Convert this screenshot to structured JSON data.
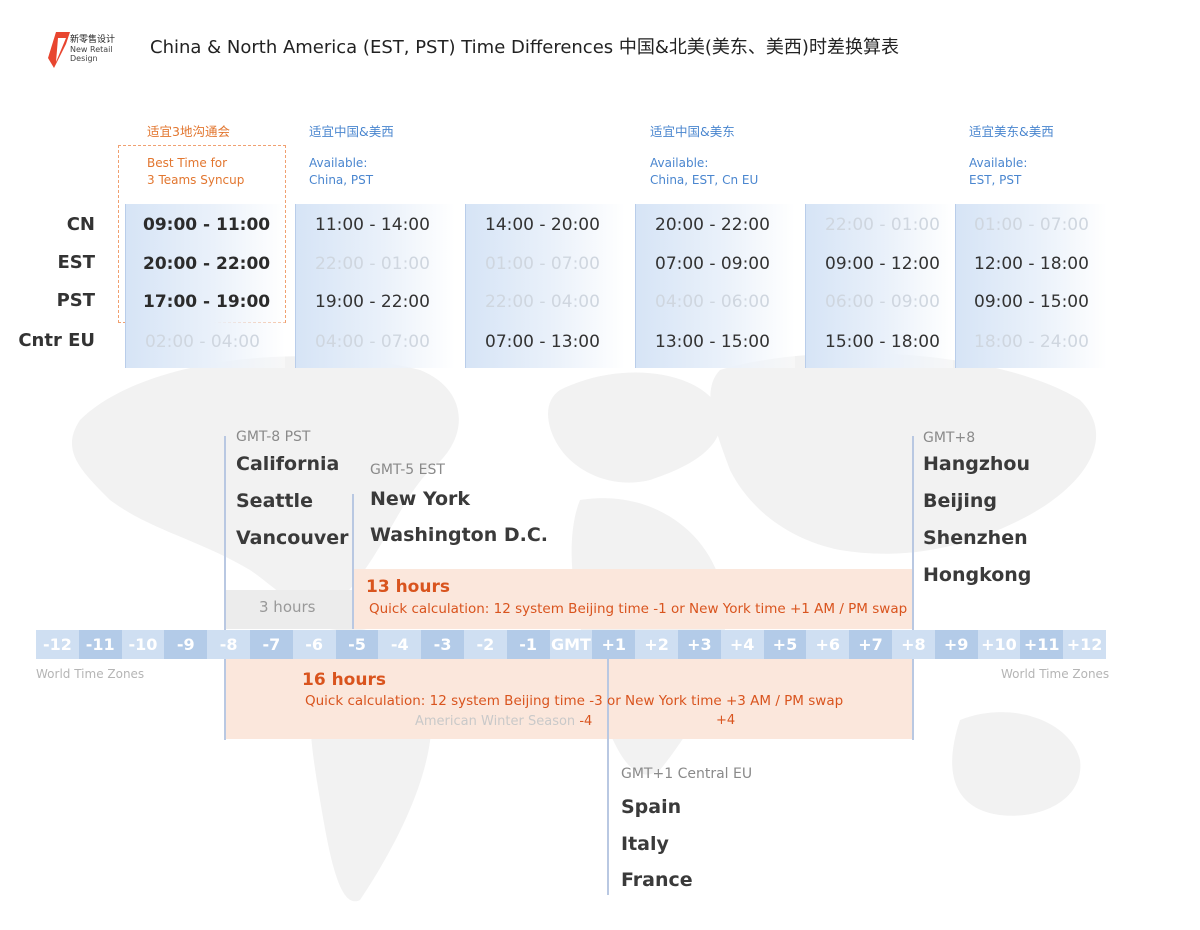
{
  "header": {
    "logo_brand": "新零售设计",
    "logo_sub1": "New Retail",
    "logo_sub2": "Design",
    "title": "China & North America (EST, PST) Time Differences 中国&北美(美东、美西)时差换算表",
    "accent_color": "#d9541e",
    "blue_color": "#4a86cf"
  },
  "columns": {
    "best": {
      "cn": "适宜3地沟通会",
      "en1": "Best Time for",
      "en2": "3 Teams Syncup"
    },
    "cn_pst": {
      "cn": "适宜中国&美西",
      "en1": "Available:",
      "en2": "China, PST"
    },
    "cn_est": {
      "cn": "适宜中国&美东",
      "en1": "Available:",
      "en2": "China, EST, Cn EU"
    },
    "est_pst": {
      "cn": "适宜美东&美西",
      "en1": "Available:",
      "en2": "EST, PST"
    }
  },
  "rows": [
    "CN",
    "EST",
    "PST",
    "Cntr EU"
  ],
  "time_table": [
    [
      "09:00 - 11:00",
      "20:00 - 22:00",
      "17:00 - 19:00",
      "02:00 - 04:00"
    ],
    [
      "11:00 - 14:00",
      "22:00 - 01:00",
      "19:00 - 22:00",
      "04:00 - 07:00"
    ],
    [
      "14:00 - 20:00",
      "01:00 - 07:00",
      "22:00 - 04:00",
      "07:00 - 13:00"
    ],
    [
      "20:00 - 22:00",
      "07:00 - 09:00",
      "04:00 - 06:00",
      "13:00 - 15:00"
    ],
    [
      "22:00 - 01:00",
      "09:00 - 12:00",
      "06:00 - 09:00",
      "15:00 - 18:00"
    ],
    [
      "01:00 - 07:00",
      "12:00 - 18:00",
      "09:00 - 15:00",
      "18:00 - 24:00"
    ]
  ],
  "zones": {
    "pst": {
      "label": "GMT-8 PST",
      "cities": [
        "California",
        "Seattle",
        "Vancouver"
      ]
    },
    "est": {
      "label": "GMT-5 EST",
      "cities": [
        "New York",
        "Washington D.C."
      ]
    },
    "cn": {
      "label": "GMT+8",
      "cities": [
        "Hangzhou",
        "Beijing",
        "Shenzhen",
        "Hongkong"
      ]
    },
    "eu": {
      "label": "GMT+1 Central EU",
      "cities": [
        "Spain",
        "Italy",
        "France"
      ]
    }
  },
  "diffs": {
    "three": "3 hours",
    "thirteen_title": "13 hours",
    "thirteen_quick": "Quick calculation: 12 system Beijing time -1 or New York time +1 AM / PM swap",
    "sixteen_title": "16 hours",
    "sixteen_quick": "Quick calculation: 12 system Beijing time -3 or New York time +3 AM / PM swap",
    "winter": "American Winter Season",
    "winter_minus": "-4",
    "winter_plus": "+4"
  },
  "scale": {
    "labels": [
      "-12",
      "-11",
      "-10",
      "-9",
      "-8",
      "-7",
      "-6",
      "-5",
      "-4",
      "-3",
      "-2",
      "-1",
      "GMT",
      "+1",
      "+2",
      "+3",
      "+4",
      "+5",
      "+6",
      "+7",
      "+8",
      "+9",
      "+10",
      "+11",
      "+12"
    ],
    "caption": "World Time Zones"
  }
}
